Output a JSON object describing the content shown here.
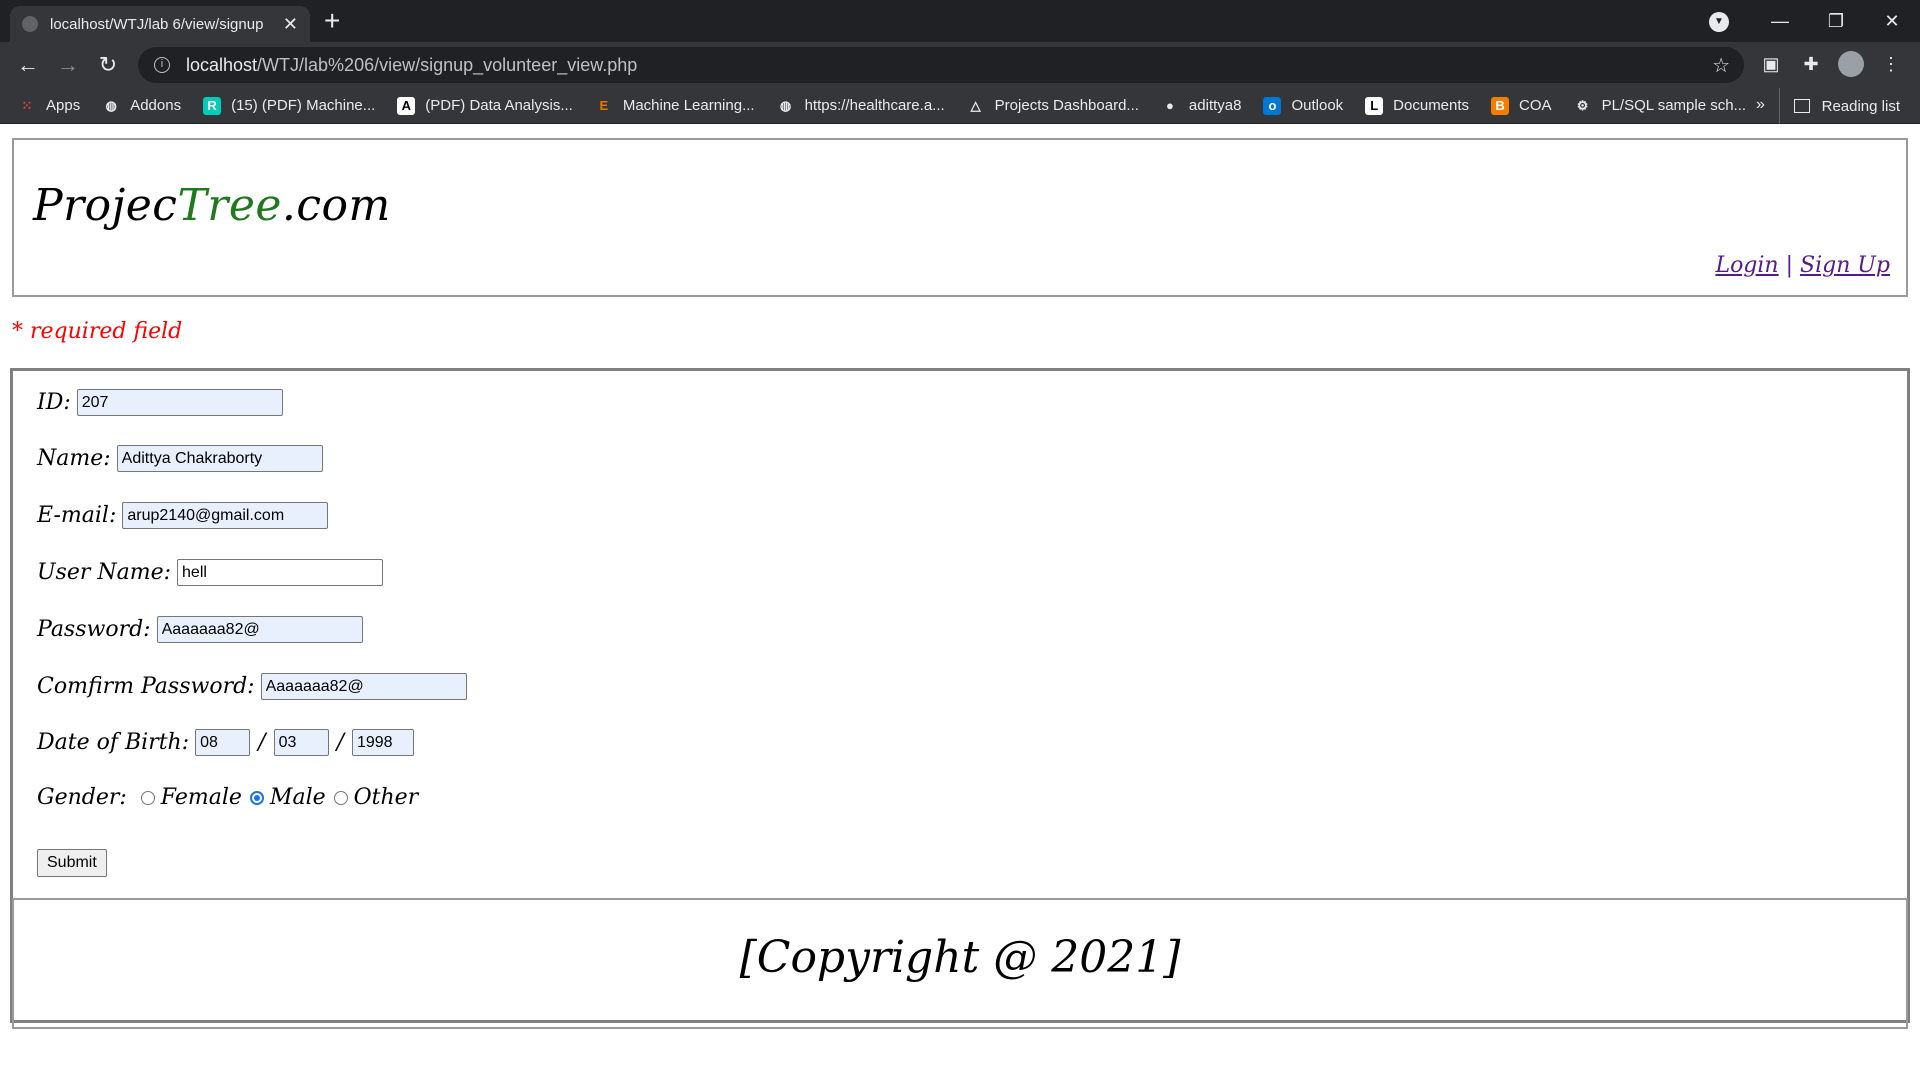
{
  "browser": {
    "tab_title": "localhost/WTJ/lab 6/view/signup",
    "url_host": "localhost",
    "url_path": "/WTJ/lab%206/view/signup_volunteer_view.php",
    "bookmarks": [
      {
        "label": "Apps",
        "icon": "apps-grid-icon",
        "color": "#ea4335"
      },
      {
        "label": "Addons",
        "icon": "globe-icon",
        "color": "#e8eaed"
      },
      {
        "label": "(15) (PDF) Machine...",
        "icon": "researchgate-icon",
        "color": "#00ccbb"
      },
      {
        "label": "(PDF) Data Analysis...",
        "icon": "academia-icon",
        "color": "#ffffff"
      },
      {
        "label": "Machine Learning...",
        "icon": "e-logo-icon",
        "color": "#e37400"
      },
      {
        "label": "https://healthcare.a...",
        "icon": "globe-icon",
        "color": "#e8eaed"
      },
      {
        "label": "Projects Dashboard...",
        "icon": "dashboard-icon",
        "color": "#e8eaed"
      },
      {
        "label": "adittya8",
        "icon": "github-icon",
        "color": "#e8eaed"
      },
      {
        "label": "Outlook",
        "icon": "outlook-icon",
        "color": "#0078d4"
      },
      {
        "label": "Documents",
        "icon": "documents-icon",
        "color": "#ffffff"
      },
      {
        "label": "COA",
        "icon": "blogger-icon",
        "color": "#f57d00"
      },
      {
        "label": "PL/SQL sample sch...",
        "icon": "sql-icon",
        "color": "#e8eaed"
      }
    ],
    "more": "»",
    "reading_list": "Reading list"
  },
  "site": {
    "logo_part1": "Projec",
    "logo_part2": "Tree",
    "logo_part3": ".com",
    "login": "Login",
    "separator": " | ",
    "signup": "Sign Up",
    "required_note": "* required field",
    "copyright": "[Copyright @ 2021]"
  },
  "form": {
    "id_label": "ID:",
    "id_value": "207",
    "name_label": "Name:",
    "name_value": "Adittya Chakraborty",
    "email_label": "E-mail:",
    "email_value": "arup2140@gmail.com",
    "username_label": "User Name:",
    "username_value": "hell",
    "password_label": "Password:",
    "password_value": "Aaaaaaa82@",
    "confirm_label": "Comfirm Password:",
    "confirm_value": "Aaaaaaa82@",
    "dob_label": "Date of Birth:",
    "dob_day": "08",
    "dob_month": "03",
    "dob_year": "1998",
    "dob_sep": "/",
    "gender_label": "Gender:",
    "gender_female": "Female",
    "gender_male": "Male",
    "gender_other": "Other",
    "gender_selected": "Male",
    "submit": "Submit"
  }
}
